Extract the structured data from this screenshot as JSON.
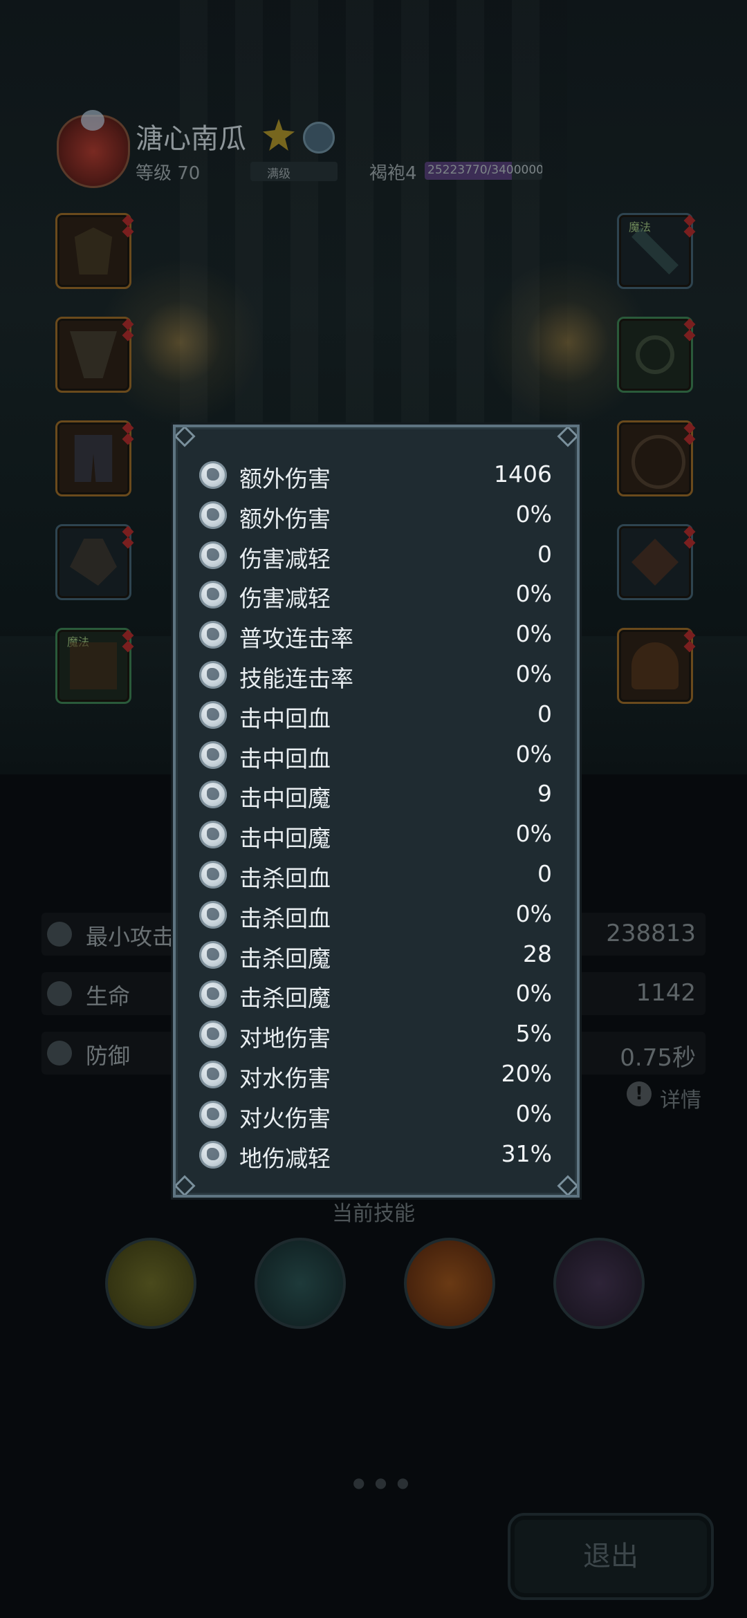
{
  "player": {
    "name": "溏心南瓜",
    "level_text": "等级 70",
    "level_status": "满级",
    "rank_label": "褐袍4",
    "exp_text": "25223770/34000000",
    "exp_progress": 0.742
  },
  "equipment": {
    "left_tag": "魔法",
    "right_tag": "魔法"
  },
  "base_stats": [
    {
      "label": "最小攻击",
      "value": "238813",
      "icon": "sword-icon"
    },
    {
      "label": "生命",
      "value": "1142",
      "icon": "heart-icon"
    },
    {
      "label": "防御",
      "value": "0.75秒",
      "icon": "shield-icon"
    }
  ],
  "detail": {
    "label": "详情"
  },
  "skills": {
    "title": "当前技能"
  },
  "exit_label": "退出",
  "attributes": [
    {
      "name": "额外伤害",
      "value": "1406",
      "icon": "extra-damage-icon"
    },
    {
      "name": "额外伤害",
      "value": "0%",
      "icon": "extra-damage-icon"
    },
    {
      "name": "伤害减轻",
      "value": "0",
      "icon": "armor-icon"
    },
    {
      "name": "伤害减轻",
      "value": "0%",
      "icon": "armor-icon"
    },
    {
      "name": "普攻连击率",
      "value": "0%",
      "icon": "combo-attack-icon"
    },
    {
      "name": "技能连击率",
      "value": "0%",
      "icon": "combo-skill-icon"
    },
    {
      "name": "击中回血",
      "value": "0",
      "icon": "hit-heal-icon"
    },
    {
      "name": "击中回血",
      "value": "0%",
      "icon": "hit-heal-icon"
    },
    {
      "name": "击中回魔",
      "value": "9",
      "icon": "hit-mana-icon"
    },
    {
      "name": "击中回魔",
      "value": "0%",
      "icon": "hit-mana-icon"
    },
    {
      "name": "击杀回血",
      "value": "0",
      "icon": "kill-heal-icon"
    },
    {
      "name": "击杀回血",
      "value": "0%",
      "icon": "kill-heal-icon"
    },
    {
      "name": "击杀回魔",
      "value": "28",
      "icon": "kill-mana-icon"
    },
    {
      "name": "击杀回魔",
      "value": "0%",
      "icon": "kill-mana-icon"
    },
    {
      "name": "对地伤害",
      "value": "5%",
      "icon": "earth-damage-icon"
    },
    {
      "name": "对水伤害",
      "value": "20%",
      "icon": "water-damage-icon"
    },
    {
      "name": "对火伤害",
      "value": "0%",
      "icon": "fire-damage-icon"
    },
    {
      "name": "地伤减轻",
      "value": "31%",
      "icon": "earth-resist-icon"
    }
  ]
}
